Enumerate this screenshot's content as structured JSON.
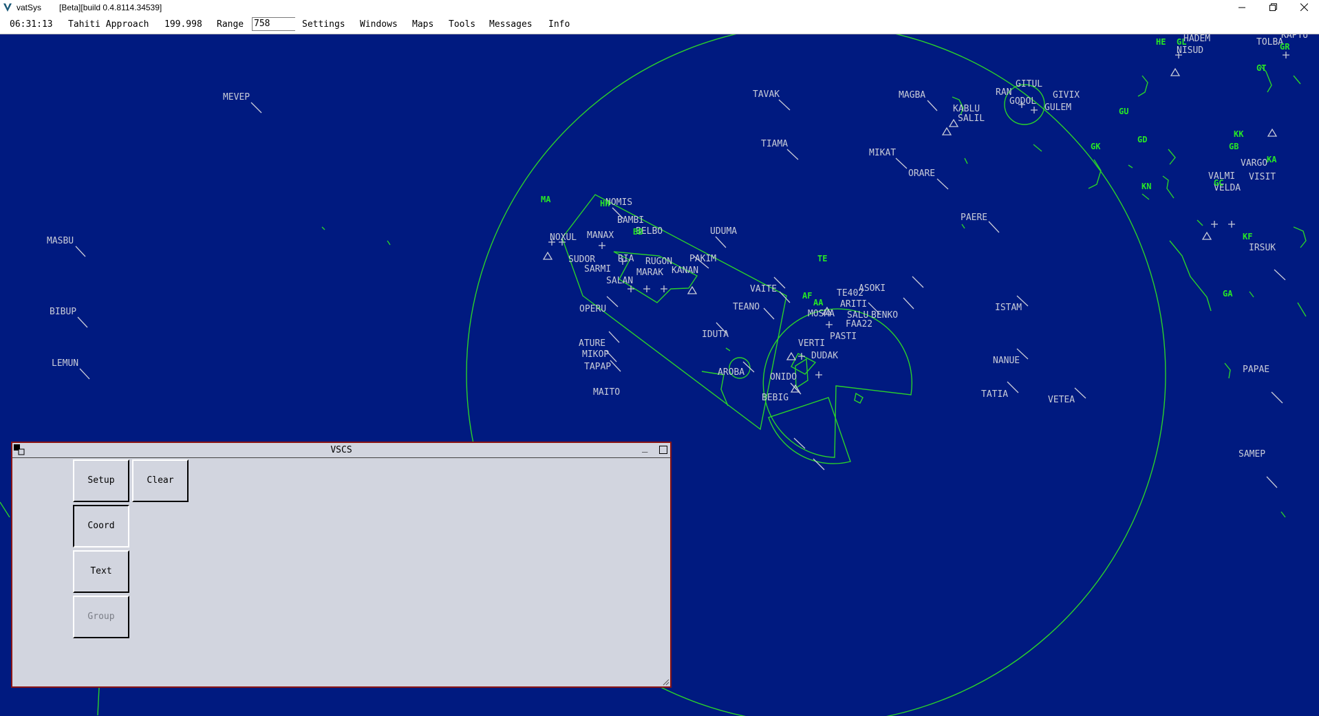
{
  "window": {
    "app_name": "vatSys",
    "build": "[Beta][build 0.4.8114.34539]"
  },
  "menubar": {
    "clock": "06:31:13",
    "position": "Tahiti Approach",
    "frequency": "199.998",
    "range_label": "Range",
    "range_value": "758",
    "menus": [
      "Settings",
      "Windows",
      "Maps",
      "Tools",
      "Messages",
      "Info"
    ]
  },
  "map": {
    "colors": {
      "background": "#001a80",
      "line": "#2ad22a",
      "fix_label": "#c9ccd8",
      "airport_label": "#26e626"
    },
    "fixes": [
      "MEVEP",
      "MASBU",
      "BIBUP",
      "LEMUN",
      "TAVAK",
      "TIAMA",
      "MIKAT",
      "ORARE",
      "MAGBA",
      "KABLU",
      "SALIL",
      "GITUL",
      "GIVIX",
      "GULEM",
      "RAN",
      "GODOL",
      "PAERE",
      "NOMIS",
      "BAMBI",
      "BELBO",
      "UDUMA",
      "SUDOR",
      "SARMI",
      "SALAN",
      "NOXUL",
      "MANAX",
      "RIA",
      "RUGON",
      "PAKIM",
      "KANAN",
      "MARAK",
      "OPERU",
      "VAITE",
      "TEANO",
      "IDUTA",
      "ATURE",
      "MIKOP",
      "TAPAP",
      "AROBA",
      "ONIDO",
      "BEBIG",
      "MAITO",
      "TE402",
      "ASOKI",
      "ARITI",
      "SALU",
      "BENKO",
      "MOSMA",
      "FAA22",
      "PASTI",
      "VERTI",
      "DUDAK",
      "ISTAM",
      "NANUE",
      "TATIA",
      "VETEA",
      "HADEM",
      "NISUD",
      "TOLBA",
      "KAPTU",
      "VARGO",
      "VISIT",
      "VALMI",
      "VELDA",
      "IRSUK",
      "PAPAE",
      "SAMEP"
    ],
    "airports": [
      "HE",
      "GL",
      "GR",
      "GT",
      "GU",
      "GK",
      "GD",
      "KK",
      "GB",
      "KA",
      "GC",
      "KN",
      "KF",
      "GA",
      "MA",
      "HH",
      "TE",
      "AA",
      "AF",
      "BB"
    ]
  },
  "vscs": {
    "title": "VSCS",
    "buttons": {
      "setup": "Setup",
      "clear": "Clear",
      "coord": "Coord",
      "text": "Text",
      "group": "Group"
    }
  }
}
